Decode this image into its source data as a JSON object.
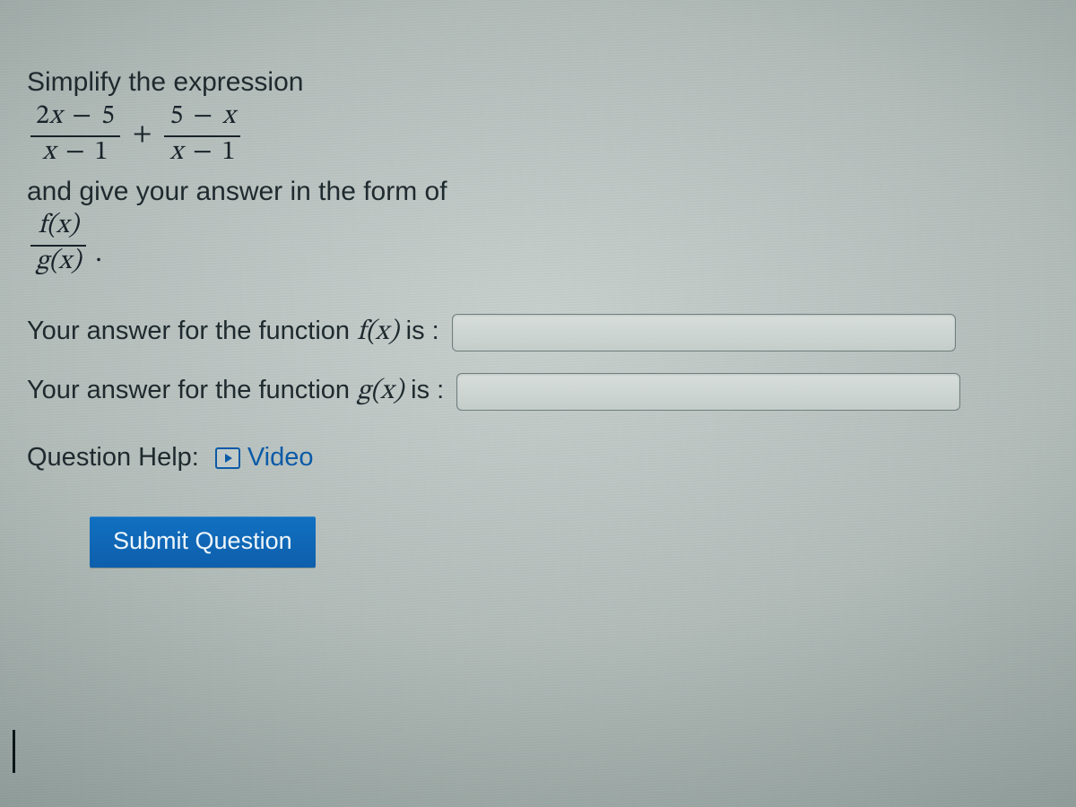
{
  "prompt": {
    "line1": "Simplify the expression",
    "line2": "and give your answer in the form of"
  },
  "expression": {
    "frac1": {
      "num_a": "2",
      "num_var": "x",
      "num_b": "5",
      "den_var": "x",
      "den_b": "1"
    },
    "op": "+",
    "frac2": {
      "num_a": "5",
      "num_var": "x",
      "den_var": "x",
      "den_b": "1"
    }
  },
  "form": {
    "top": "f(x)",
    "bottom": "g(x)"
  },
  "answers": {
    "f": {
      "label_pre": "Your answer for the function ",
      "fn": "f(x)",
      "label_post": " is :",
      "value": ""
    },
    "g": {
      "label_pre": "Your answer for the function ",
      "fn": "g(x)",
      "label_post": " is :",
      "value": ""
    }
  },
  "help": {
    "label": "Question Help:",
    "video": "Video"
  },
  "submit": "Submit Question"
}
